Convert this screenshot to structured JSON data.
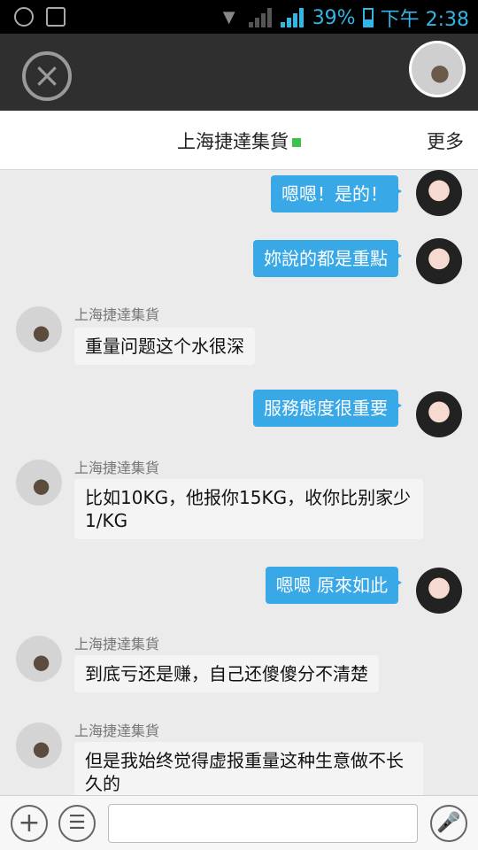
{
  "status_bar": {
    "battery": "39%",
    "time": "下午 2:38"
  },
  "header": {
    "close_icon": "close-circle-icon"
  },
  "title_bar": {
    "title": "上海捷達集貨",
    "more": "更多"
  },
  "messages": [
    {
      "from": "me",
      "text": "嗯嗯！是的！"
    },
    {
      "from": "me",
      "text": "妳說的都是重點"
    },
    {
      "from": "other",
      "sender": "上海捷達集貨",
      "text": "重量问题这个水很深"
    },
    {
      "from": "me",
      "text": "服務態度很重要"
    },
    {
      "from": "other",
      "sender": "上海捷達集貨",
      "text": "比如10KG，他报你15KG，收你比别家少1/KG"
    },
    {
      "from": "me",
      "text": "嗯嗯 原來如此"
    },
    {
      "from": "other",
      "sender": "上海捷達集貨",
      "text": "到底亏还是赚，自己还傻傻分不清楚"
    },
    {
      "from": "other",
      "sender": "上海捷達集貨",
      "text": "但是我始终觉得虚报重量这种生意做不长久的"
    }
  ],
  "input_bar": {
    "value": ""
  }
}
